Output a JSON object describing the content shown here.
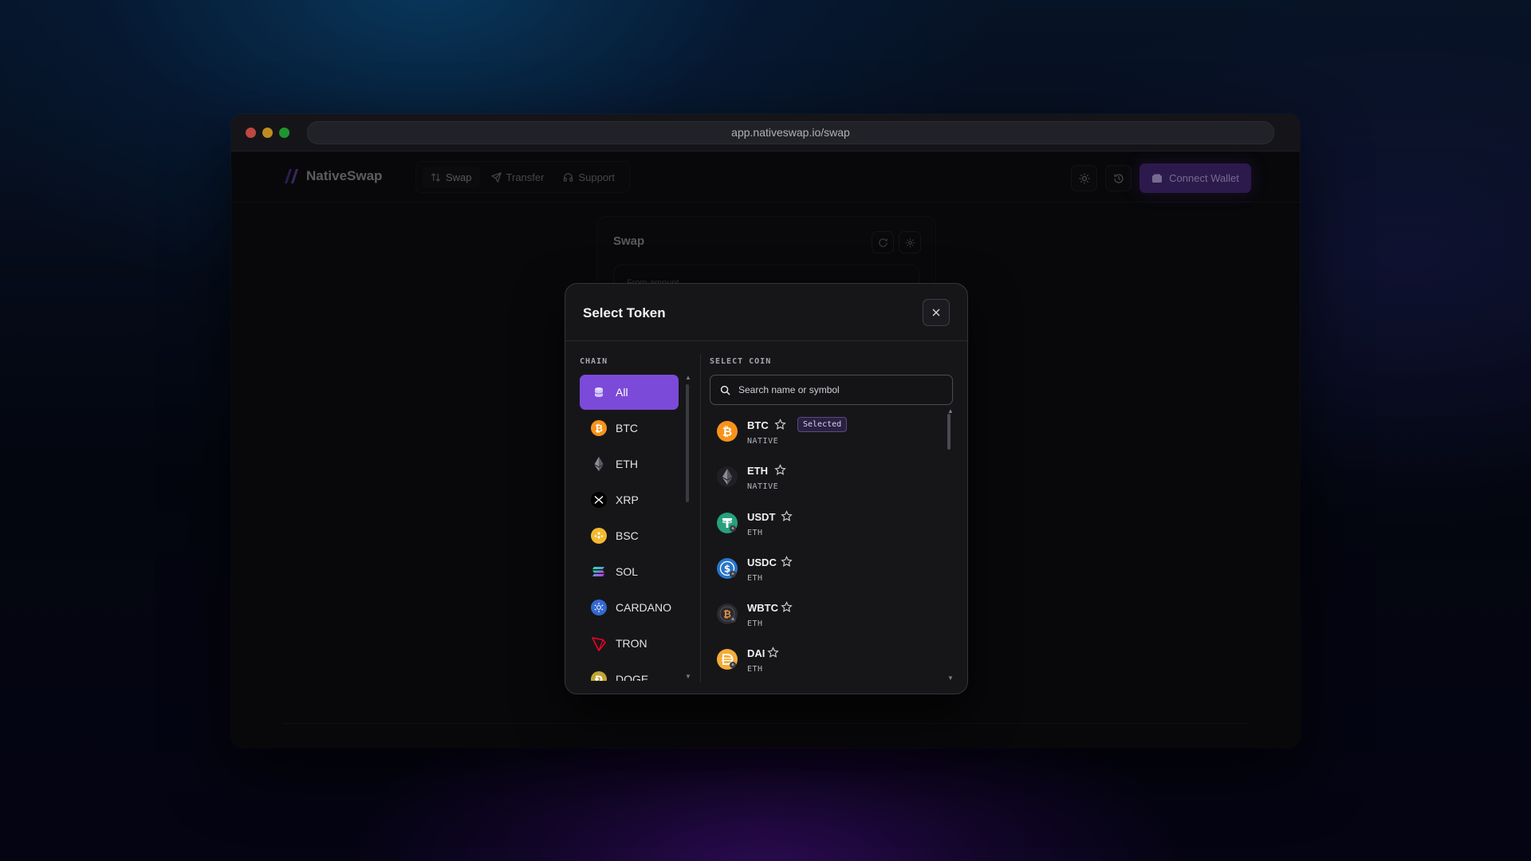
{
  "browser": {
    "url": "app.nativeswap.io/swap"
  },
  "app": {
    "brand": "NativeSwap",
    "nav": [
      {
        "label": "Swap",
        "icon": "arrows-up-down-icon"
      },
      {
        "label": "Transfer",
        "icon": "send-icon"
      },
      {
        "label": "Support",
        "icon": "headset-icon"
      }
    ],
    "connect_label": "Connect Wallet",
    "swap_card": {
      "title": "Swap",
      "from_label": "From amount"
    }
  },
  "modal": {
    "title": "Select Token",
    "chain_label": "CHAIN",
    "coin_label": "SELECT COIN",
    "search_placeholder": "Search name or symbol",
    "chains": [
      {
        "label": "All",
        "icon": "stack-icon",
        "active": true
      },
      {
        "label": "BTC",
        "icon": "bitcoin-icon"
      },
      {
        "label": "ETH",
        "icon": "ethereum-icon"
      },
      {
        "label": "XRP",
        "icon": "xrp-icon"
      },
      {
        "label": "BSC",
        "icon": "bnb-icon"
      },
      {
        "label": "SOL",
        "icon": "solana-icon"
      },
      {
        "label": "CARDANO",
        "icon": "cardano-icon"
      },
      {
        "label": "TRON",
        "icon": "tron-icon"
      },
      {
        "label": "DOGE",
        "icon": "dogecoin-icon"
      }
    ],
    "coins": [
      {
        "symbol": "BTC",
        "network": "NATIVE",
        "badge": "Selected",
        "icon": "bitcoin-icon"
      },
      {
        "symbol": "ETH",
        "network": "NATIVE",
        "icon": "ethereum-icon"
      },
      {
        "symbol": "USDT",
        "network": "ETH",
        "icon": "tether-icon"
      },
      {
        "symbol": "USDC",
        "network": "ETH",
        "icon": "usdc-icon"
      },
      {
        "symbol": "WBTC",
        "network": "ETH",
        "icon": "wbtc-icon"
      },
      {
        "symbol": "DAI",
        "network": "ETH",
        "icon": "dai-icon"
      }
    ]
  },
  "colors": {
    "accent": "#7c4ad8",
    "modal_bg": "#161619",
    "page_bg": "#0b0b0e"
  }
}
